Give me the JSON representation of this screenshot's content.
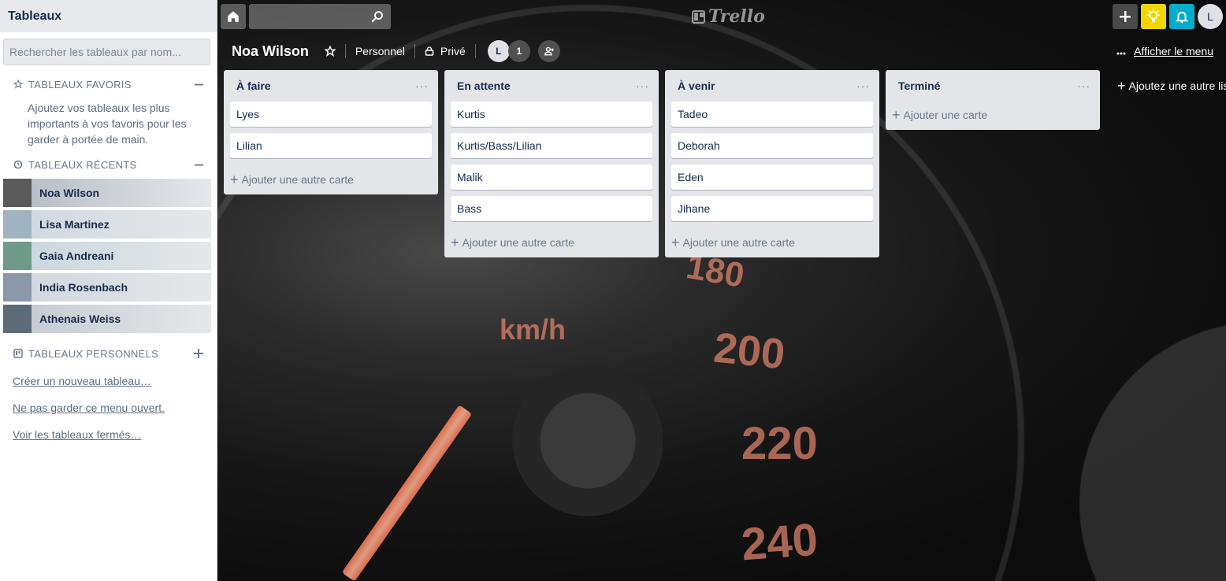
{
  "sidebar": {
    "title": "Tableaux",
    "search_placeholder": "Rechercher les tableaux par nom...",
    "favorites": {
      "title": "TABLEAUX FAVORIS",
      "text": "Ajoutez vos tableaux les plus importants à vos favoris pour les garder à portée de main."
    },
    "recent": {
      "title": "TABLEAUX RÉCENTS",
      "boards": [
        {
          "name": "Noa Wilson",
          "thumb": "#5a5a5a",
          "bg": "#9aa3ab"
        },
        {
          "name": "Lisa Martinez",
          "thumb": "#9fb3c0",
          "bg": "#c7d3dc"
        },
        {
          "name": "Gaia Andreani",
          "thumb": "#6f9a8a",
          "bg": "#b9d0d6"
        },
        {
          "name": "India Rosenbach",
          "thumb": "#8a98a8",
          "bg": "#c9d1da"
        },
        {
          "name": "Athenais Weiss",
          "thumb": "#5b6b78",
          "bg": "#b3bcc5"
        }
      ]
    },
    "personal": {
      "title": "TABLEAUX PERSONNELS"
    },
    "links": [
      "Créer un nouveau tableau…",
      "Ne pas garder ce menu ouvert.",
      "Voir les tableaux fermés…"
    ]
  },
  "topbar": {
    "logo": "Trello",
    "avatar": "L",
    "colors": {
      "add": "#4a4a4a",
      "idea": "#f2d600",
      "notif": "#00aecc"
    }
  },
  "board": {
    "title": "Noa Wilson",
    "team": "Personnel",
    "visibility": "Privé",
    "member_initial": "L",
    "member_count": "1",
    "show_menu": "Afficher le menu",
    "add_list": "Ajoutez une autre liste",
    "dial_numbers": [
      "kmh",
      "180",
      "200",
      "220",
      "240"
    ],
    "lists": [
      {
        "title": "À faire",
        "cards": [
          "Lyes",
          "Lilian"
        ],
        "add": "Ajouter une autre carte"
      },
      {
        "title": "En attente",
        "cards": [
          "Kurtis",
          "Kurtis/Bass/Lilian",
          "Malik",
          "Bass"
        ],
        "add": "Ajouter une autre carte"
      },
      {
        "title": "À venir",
        "cards": [
          "Tadeo",
          "Deborah",
          "Eden",
          "Jihane"
        ],
        "add": "Ajouter une autre carte"
      },
      {
        "title": "Terminé",
        "cards": [],
        "add": "Ajouter une carte"
      }
    ]
  },
  "dial": {
    "unit": "km/h",
    "marks": [
      "180",
      "200",
      "220",
      "240"
    ]
  }
}
